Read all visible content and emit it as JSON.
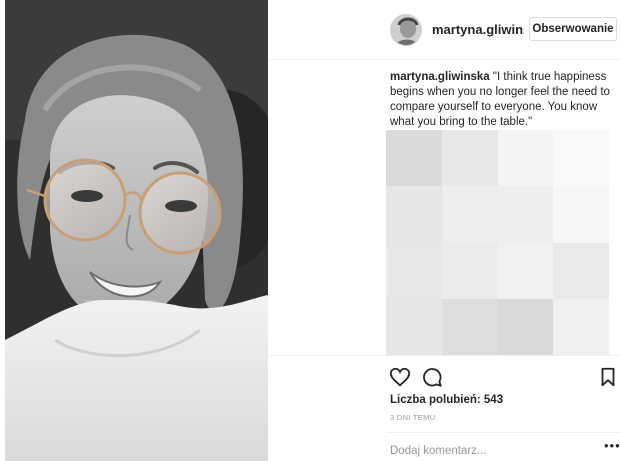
{
  "post": {
    "image_alt": "selfie",
    "username": "martyna.gliwinsl",
    "follow_label": "Obserwowanie",
    "caption_user": "martyna.gliwinska",
    "caption_text": " \"I think true happiness begins when you no longer feel the need to compare yourself to everyone. You know what you bring to the table.\"",
    "likes_text": "Liczba polubień: 543",
    "timestamp": "3 DNI TEMU",
    "comment_placeholder": "Dodaj komentarz...",
    "more_label": "•••"
  },
  "icons": {
    "heart": "heart-icon",
    "comment": "comment-icon",
    "bookmark": "bookmark-icon",
    "avatar": "avatar"
  },
  "colors": {
    "text": "#262626",
    "muted": "#999999",
    "border": "#dbdbdb",
    "divider": "#efefef"
  },
  "blur_cells": [
    "#dcdad8",
    "#e8e8e6",
    "#f4f4f4",
    "#f9f9f9",
    "#e6e6e6",
    "#ecedec",
    "#eeeeee",
    "#f6f6f6",
    "#e7e7e7",
    "#ebebeb",
    "#f1f1f1",
    "#e8e9e9",
    "#e6e6e6",
    "#dedede",
    "#d9d9d9",
    "#f0f0f0"
  ]
}
